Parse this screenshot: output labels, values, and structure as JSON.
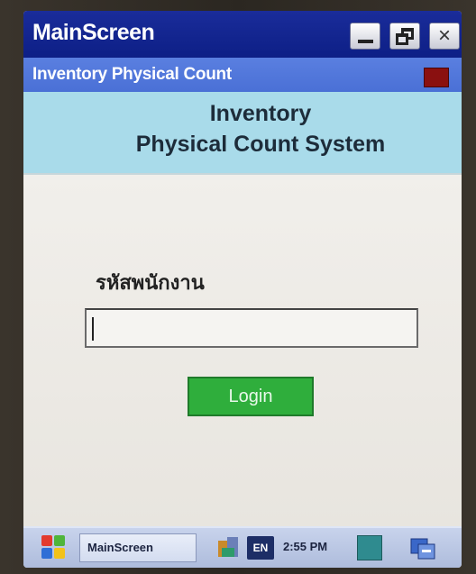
{
  "window": {
    "title": "MainScreen"
  },
  "form": {
    "caption": "Inventory Physical Count",
    "banner_line1": "Inventory",
    "banner_line2": "Physical Count System",
    "employee_id_label": "รหัสพนักงาน",
    "employee_id_value": "",
    "login_label": "Login"
  },
  "taskbar": {
    "task_label": "MainScreen",
    "language": "EN",
    "clock": "2:55 PM"
  },
  "icons": {
    "close": "×"
  },
  "colors": {
    "titlebar": "#0d1f86",
    "formbar": "#4a70d6",
    "banner": "#a9dbea",
    "login_button": "#2fae3c"
  }
}
